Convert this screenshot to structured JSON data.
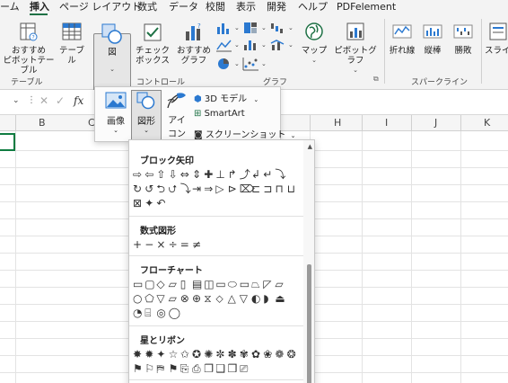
{
  "menu": {
    "tabs": [
      "ーム",
      "挿入",
      "ページ レイアウト",
      "数式",
      "データ",
      "校閲",
      "表示",
      "開発",
      "ヘルプ",
      "PDFelement"
    ],
    "active_tab": "挿入"
  },
  "ribbon": {
    "recommended_pivot_line1": "おすすめ",
    "recommended_pivot_line2": "ピボットテーブル",
    "table_label": "テーブル",
    "illustrations_label": "図",
    "checkbox_line1": "チェック",
    "checkbox_line2": "ボックス",
    "recommended_charts_line1": "おすすめ",
    "recommended_charts_line2": "グラフ",
    "maps_label": "マップ",
    "pivotchart_label": "ピボットグラフ",
    "sparkline_line": "折れ線",
    "sparkline_column": "縦棒",
    "sparkline_winloss": "勝敗",
    "slicer_label": "スライ",
    "group_tables": "テーブル",
    "group_controls": "コントロール",
    "group_charts": "グラフ",
    "group_sparklines": "スパークライン"
  },
  "formula_bar": {
    "fx_label": "fx"
  },
  "columns": [
    "B",
    "C",
    "H",
    "I",
    "J",
    "K"
  ],
  "illustrations_popup": {
    "pictures_label": "画像",
    "shapes_label": "図形",
    "icons_line1": "アイ",
    "icons_line2": "コン",
    "models_label": "3D モデル",
    "smartart_label": "SmartArt",
    "screenshot_label": "スクリーンショット"
  },
  "shape_gallery": {
    "sections": [
      {
        "title": "ブロック矢印",
        "row_count": 3
      },
      {
        "title": "数式図形",
        "row_count": 1
      },
      {
        "title": "フローチャート",
        "row_count": 3
      },
      {
        "title": "星とリボン",
        "row_count": 2
      }
    ]
  },
  "colors": {
    "accent_green": "#1e7145",
    "active_cell": "#107c41",
    "icon_blue": "#2b79d0"
  }
}
